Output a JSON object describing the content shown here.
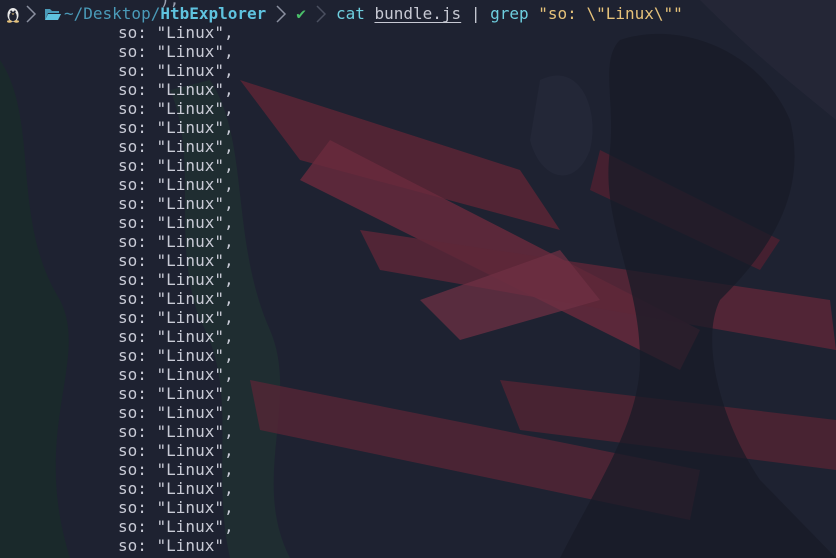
{
  "prompt": {
    "os_icon": "linux-tux-icon",
    "folder_icon": "folder-open-icon",
    "path_prefix": "~/Desktop/",
    "path_current": "HtbExplorer",
    "status_glyph": "✔",
    "command": "cat",
    "argument": "bundle.js",
    "pipe": "|",
    "filter_cmd": "grep",
    "filter_pattern": "\"so: \\\"Linux\\\"\""
  },
  "partial_previous_line": "),",
  "output_lines": [
    "so: \"Linux\",",
    "so: \"Linux\",",
    "so: \"Linux\",",
    "so: \"Linux\",",
    "so: \"Linux\",",
    "so: \"Linux\",",
    "so: \"Linux\",",
    "so: \"Linux\",",
    "so: \"Linux\",",
    "so: \"Linux\",",
    "so: \"Linux\",",
    "so: \"Linux\",",
    "so: \"Linux\",",
    "so: \"Linux\",",
    "so: \"Linux\",",
    "so: \"Linux\",",
    "so: \"Linux\",",
    "so: \"Linux\",",
    "so: \"Linux\",",
    "so: \"Linux\",",
    "so: \"Linux\",",
    "so: \"Linux\",",
    "so: \"Linux\",",
    "so: \"Linux\",",
    "so: \"Linux\",",
    "so: \"Linux\",",
    "so: \"Linux\",",
    "so: \"Linux\""
  ],
  "colors": {
    "background": "#1e2231",
    "path": "#4a9ab8",
    "path_current": "#5fc3df",
    "check": "#4bc06a",
    "command": "#6ecfdf",
    "string": "#e6c27a"
  }
}
